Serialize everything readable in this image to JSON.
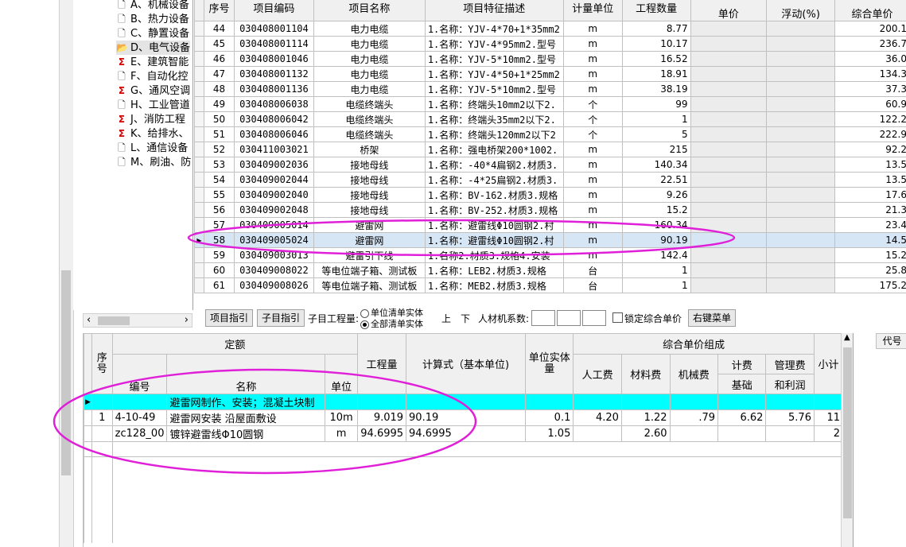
{
  "tree": {
    "items": [
      {
        "icon": "doc",
        "label": "A、机械设备"
      },
      {
        "icon": "doc",
        "label": "B、热力设备"
      },
      {
        "icon": "doc",
        "label": "C、静置设备"
      },
      {
        "icon": "folder",
        "label": "D、电气设备"
      },
      {
        "icon": "sigma",
        "label": "E、建筑智能"
      },
      {
        "icon": "doc",
        "label": "F、自动化控"
      },
      {
        "icon": "sigma",
        "label": "G、通风空调"
      },
      {
        "icon": "doc",
        "label": "H、工业管道"
      },
      {
        "icon": "sigma",
        "label": "J、消防工程"
      },
      {
        "icon": "sigma",
        "label": "K、给排水、"
      },
      {
        "icon": "doc",
        "label": "L、通信设备"
      },
      {
        "icon": "doc",
        "label": "M、刷油、防"
      }
    ]
  },
  "top_table": {
    "headers": [
      "序号",
      "项目编码",
      "项目名称",
      "项目特征描述",
      "计量单位",
      "工程数量",
      "单价",
      "浮动(%)",
      "综合单价"
    ],
    "rows": [
      {
        "no": "44",
        "code": "030408001104",
        "name": "电力电缆",
        "desc": "1.名称：YJV-4*70+1*35mm2",
        "unit": "m",
        "qty": "8.77",
        "price": "200.1"
      },
      {
        "no": "45",
        "code": "030408001114",
        "name": "电力电缆",
        "desc": "1.名称：YJV-4*95mm2.型号",
        "unit": "m",
        "qty": "10.17",
        "price": "236.7"
      },
      {
        "no": "46",
        "code": "030408001046",
        "name": "电力电缆",
        "desc": "1.名称：YJV-5*10mm2.型号",
        "unit": "m",
        "qty": "16.52",
        "price": "36.0"
      },
      {
        "no": "47",
        "code": "030408001132",
        "name": "电力电缆",
        "desc": "1.名称：YJV-4*50+1*25mm2",
        "unit": "m",
        "qty": "18.91",
        "price": "134.3"
      },
      {
        "no": "48",
        "code": "030408001136",
        "name": "电力电缆",
        "desc": "1.名称：YJV-5*10mm2.型号",
        "unit": "m",
        "qty": "38.19",
        "price": "37.3"
      },
      {
        "no": "49",
        "code": "030408006038",
        "name": "电缆终端头",
        "desc": "1.名称：终端头10mm2以下2.",
        "unit": "个",
        "qty": "99",
        "price": "60.9"
      },
      {
        "no": "50",
        "code": "030408006042",
        "name": "电缆终端头",
        "desc": "1.名称：终端头35mm2以下2.",
        "unit": "个",
        "qty": "1",
        "price": "122.2"
      },
      {
        "no": "51",
        "code": "030408006046",
        "name": "电缆终端头",
        "desc": "1.名称：终端头120mm2以下2",
        "unit": "个",
        "qty": "5",
        "price": "222.9"
      },
      {
        "no": "52",
        "code": "030411003021",
        "name": "桥架",
        "desc": "1.名称：强电桥架200*1002.",
        "unit": "m",
        "qty": "215",
        "price": "92.2"
      },
      {
        "no": "53",
        "code": "030409002036",
        "name": "接地母线",
        "desc": "1.名称：-40*4扁钢2.材质3.",
        "unit": "m",
        "qty": "140.34",
        "price": "13.5"
      },
      {
        "no": "54",
        "code": "030409002044",
        "name": "接地母线",
        "desc": "1.名称：-4*25扁钢2.材质3.",
        "unit": "m",
        "qty": "22.51",
        "price": "13.5"
      },
      {
        "no": "55",
        "code": "030409002040",
        "name": "接地母线",
        "desc": "1.名称：BV-162.材质3.规格",
        "unit": "m",
        "qty": "9.26",
        "price": "17.6"
      },
      {
        "no": "56",
        "code": "030409002048",
        "name": "接地母线",
        "desc": "1.名称：BV-252.材质3.规格",
        "unit": "m",
        "qty": "15.2",
        "price": "21.3"
      },
      {
        "no": "57",
        "code": "030409005014",
        "name": "避雷网",
        "desc": "1.名称：避雷线Φ10圆钢2.村",
        "unit": "m",
        "qty": "160.34",
        "price": "23.4"
      },
      {
        "no": "58",
        "code": "030409005024",
        "name": "避雷网",
        "desc": "1.名称：避雷线Φ10圆钢2.村",
        "unit": "m",
        "qty": "90.19",
        "price": "14.5"
      },
      {
        "no": "59",
        "code": "030409003013",
        "name": "避雷引下线",
        "desc": "1.名称2.材质3.规格4.安装",
        "unit": "m",
        "qty": "142.4",
        "price": "15.2"
      },
      {
        "no": "60",
        "code": "030409008022",
        "name": "等电位端子箱、测试板",
        "desc": "1.名称：LEB2.材质3.规格",
        "unit": "台",
        "qty": "1",
        "price": "25.8"
      },
      {
        "no": "61",
        "code": "030409008026",
        "name": "等电位端子箱、测试板",
        "desc": "1.名称：MEB2.材质3.规格",
        "unit": "台",
        "qty": "1",
        "price": "175.2"
      }
    ]
  },
  "toolbar": {
    "btn_item_guide": "项目指引",
    "btn_sub_guide": "子目指引",
    "sub_project_label": "子目工程量:",
    "radio_unit": "单位清单实体",
    "radio_all": "全部清单实体",
    "up": "上",
    "down": "下",
    "coef_label": "人材机系数:",
    "lock_label": "锁定综合单价",
    "btn_right_menu": "右键菜单"
  },
  "bottom_table": {
    "h_no": "序号",
    "h_quota": "定额",
    "h_code": "编号",
    "h_name": "名称",
    "h_unit": "单位",
    "h_qty": "工程量",
    "h_formula": "计算式（基本单位)",
    "h_unit_entity": "单位实体量",
    "h_composition": "综合单价组成",
    "h_labor": "人工费",
    "h_material": "材料费",
    "h_machine": "机械费",
    "h_calc": "计费",
    "h_base": "基础",
    "h_mgmt": "管理费",
    "h_profit": "和利润",
    "h_subtotal": "小计",
    "group_row": "避雷网制作、安装；混凝土块制",
    "rows": [
      {
        "no": "1",
        "code": "4-10-49",
        "name": "避雷网安装 沿屋面敷设",
        "unit": "10m",
        "qty": "9.019",
        "formula": "90.19",
        "entity": "0.1",
        "labor": "4.20",
        "material": "1.22",
        "machine": ".79",
        "base": "6.62",
        "mgmt": "5.76",
        "subtotal": "11"
      },
      {
        "no": "",
        "code": "zc128_00",
        "name": "镀锌避雷线Φ10圆钢",
        "unit": "m",
        "qty": "94.6995",
        "formula": "94.6995",
        "entity": "1.05",
        "labor": "",
        "material": "2.60",
        "machine": "",
        "base": "",
        "mgmt": "",
        "subtotal": "2"
      }
    ]
  },
  "right_panel": {
    "header": "代号"
  },
  "colors": {
    "highlight_ellipse": "#e020d8",
    "group_row": "#00ffff",
    "selected_row": "#d7e6f5"
  }
}
